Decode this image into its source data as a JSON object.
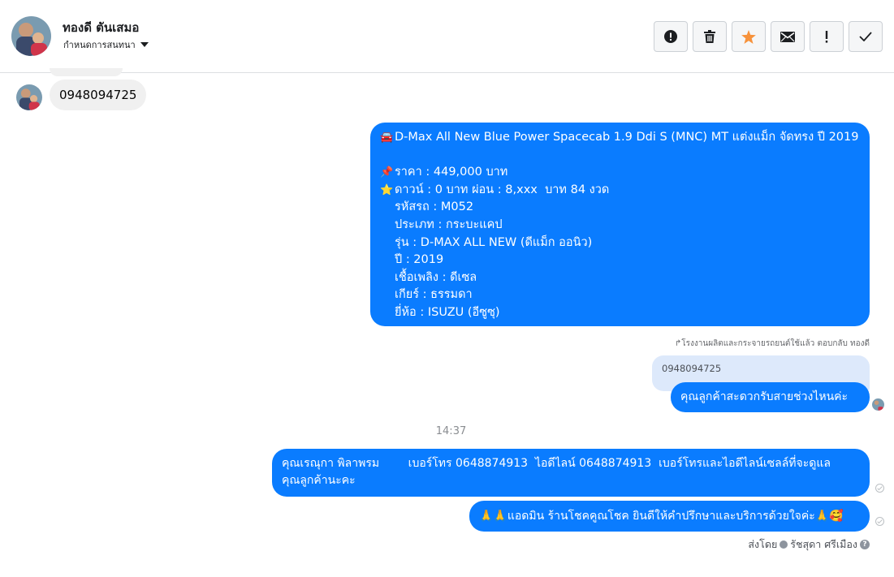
{
  "header": {
    "contact_name": "ทองดี ตันเสมอ",
    "conversation_settings": "กำหนดการสนทนา",
    "actions": [
      {
        "name": "report-button",
        "icon": "alert-circle-icon"
      },
      {
        "name": "delete-button",
        "icon": "trash-icon"
      },
      {
        "name": "star-button",
        "icon": "star-icon",
        "color": "#f7923b"
      },
      {
        "name": "mail-button",
        "icon": "envelope-icon"
      },
      {
        "name": "important-button",
        "icon": "exclamation-icon"
      },
      {
        "name": "done-button",
        "icon": "checkmark-icon"
      }
    ]
  },
  "messages": {
    "incoming_phone": "0948094725",
    "car_listing": {
      "title_emoji": "🚘",
      "title": "D-Max All New Blue Power Spacecab 1.9 Ddi S (MNC) MT แต่งแม็ก จัดทรง ปี 2019",
      "price_emoji": "📌",
      "price": "ราคา : 449,000 บาท",
      "down_emoji": "⭐",
      "down": "ดาวน์ : 0 บาท ผ่อน : 8,xxx  บาท 84 งวด",
      "details": [
        "รหัสรถ : M052",
        "ประเภท : กระบะแคป",
        "รุ่น : D-MAX ALL NEW (ดีแม็ก ออนิว)",
        "ปี : 2019",
        "เชื้อเพลิง : ดีเซล",
        "เกียร์ : ธรรมดา",
        "ยี่ห้อ : ISUZU (อีซูซุ)"
      ]
    },
    "reply_label": "โรงงานผลิตและกระจายรถยนต์ใช้แล้ว ตอบกลับ ทองดี",
    "quoted_text": "0948094725",
    "reply_text": "คุณลูกค้าสะดวกรับสายช่วงไหนค่ะ",
    "timestamp": "14:37",
    "agent_line1": "คุณเรณุกา พิลาพรม        เบอร์โทร 0648874913  ไอดีไลน์ 0648874913  เบอร์โทรและไอดีไลน์เซลล์ที่จะดูแล",
    "agent_line2": "คุณลูกค้านะคะ",
    "thanks_text": "🙏🙏แอดมิน ร้านโชคคูณโชค ยินดีให้คำปรึกษาและบริการด้วยใจค่ะ🙏🥰",
    "sent_by_label": "ส่งโดย",
    "sent_by_name": "รัชสุดา ศรีเมือง"
  },
  "colors": {
    "outgoing_bubble": "#0a7cff",
    "incoming_bubble": "#f0f0f0",
    "quoted_bubble": "#dde9fb",
    "star_accent": "#f7923b"
  }
}
